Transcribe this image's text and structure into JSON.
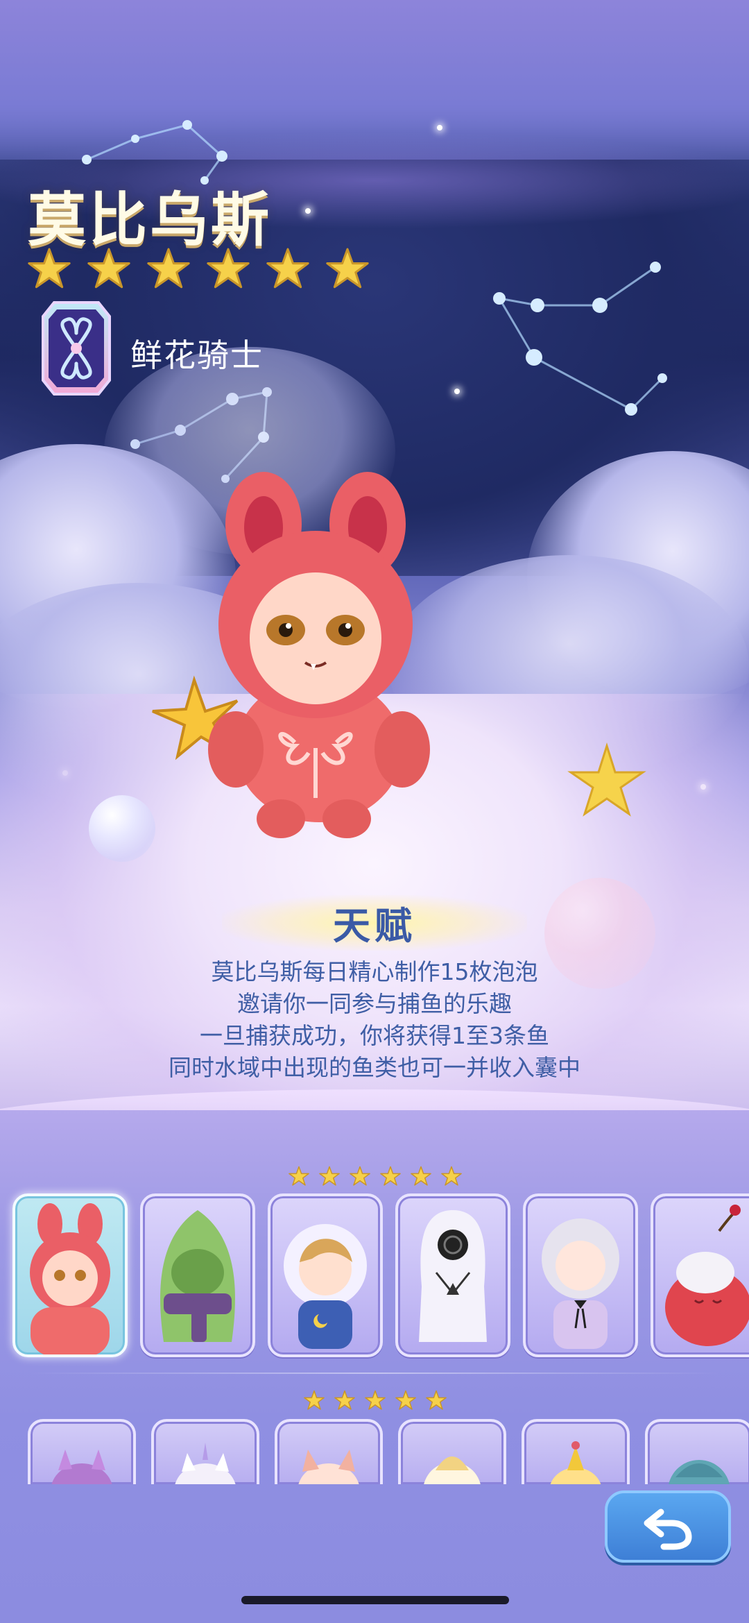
{
  "character": {
    "name": "莫比乌斯",
    "star_count": 6,
    "role_icon": "flower-knight-emblem-icon",
    "role_label": "鲜花骑士"
  },
  "talent": {
    "title": "天赋",
    "lines": [
      "莫比乌斯每日精心制作15枚泡泡",
      "邀请你一同参与捕鱼的乐趣",
      "一旦捕获成功，你将获得1至3条鱼",
      "同时水域中出现的鱼类也可一并收入囊中"
    ]
  },
  "roster": {
    "six_star_count": 6,
    "five_star_count": 5,
    "six_star_cards": [
      {
        "name": "pink-bunny-hood-character",
        "selected": true
      },
      {
        "name": "green-hooded-scarf-character",
        "selected": false
      },
      {
        "name": "blonde-boy-moon-pajamas-character",
        "selected": false
      },
      {
        "name": "white-ghost-swirl-mask-character",
        "selected": false
      },
      {
        "name": "silver-hair-girl-character",
        "selected": false
      },
      {
        "name": "apple-sleeper-character",
        "selected": false
      }
    ],
    "five_star_cards": [
      {
        "name": "purple-spiky-character"
      },
      {
        "name": "unicorn-cat-character"
      },
      {
        "name": "fox-ears-character"
      },
      {
        "name": "blond-tuft-character"
      },
      {
        "name": "party-hat-character"
      },
      {
        "name": "teal-hair-character"
      }
    ]
  },
  "controls": {
    "back_icon": "return-arrow-icon"
  },
  "colors": {
    "accent_blue": "#3e7fd6",
    "star_gold": "#f6d14a",
    "talent_text": "#3f5ea5"
  }
}
